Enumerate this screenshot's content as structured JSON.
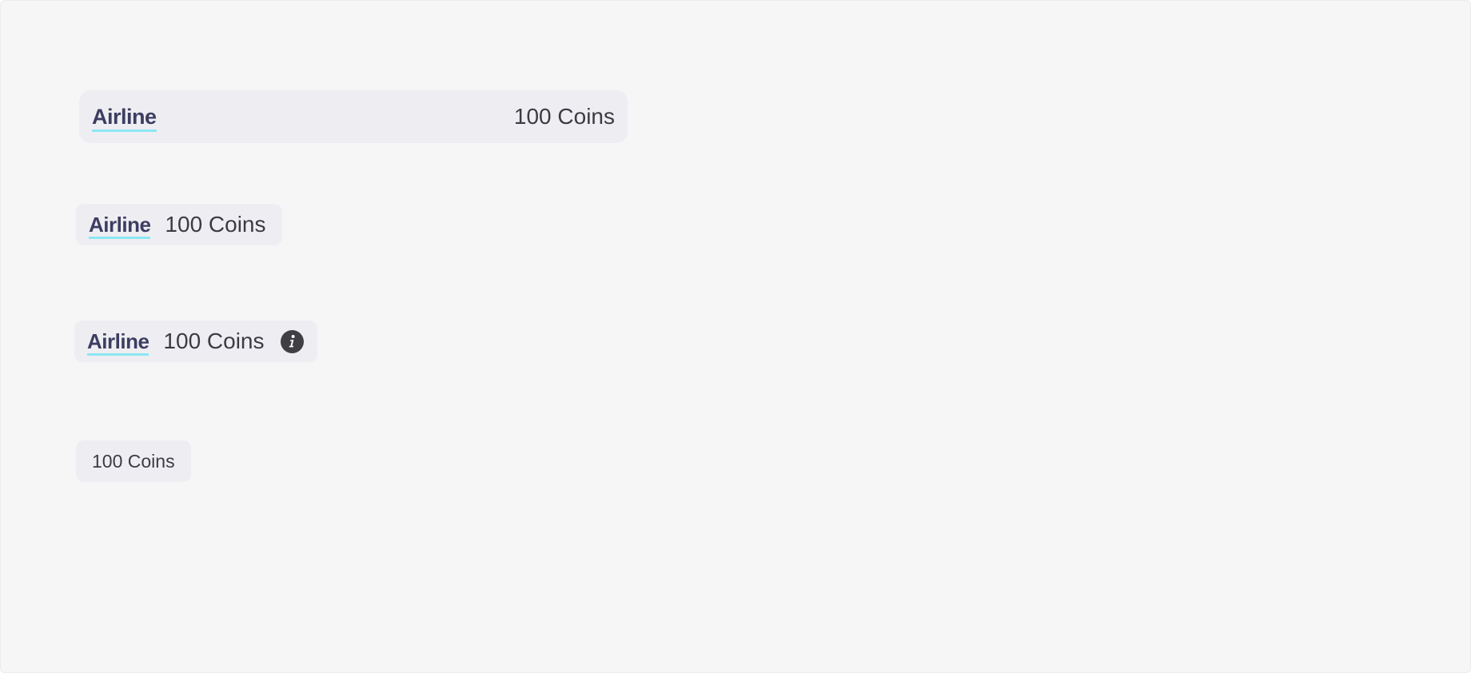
{
  "chips": {
    "wide": {
      "logo": "Airline",
      "amount": "100 Coins"
    },
    "compact": {
      "logo": "Airline",
      "amount": "100 Coins"
    },
    "with_info": {
      "logo": "Airline",
      "amount": "100 Coins",
      "icon": "info-icon"
    },
    "amount_only": {
      "amount": "100 Coins"
    }
  },
  "colors": {
    "background": "#f6f6f7",
    "chip": "#eeeef2",
    "logo_text": "#3d3d63",
    "logo_underline": "#7fe6f2",
    "amount_text": "#3b3b43",
    "info_icon": "#3f3f44"
  }
}
